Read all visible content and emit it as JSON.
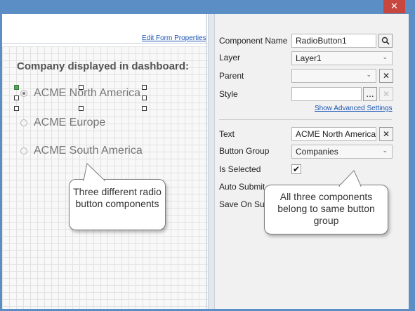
{
  "window": {
    "close_glyph": "✕"
  },
  "canvas": {
    "edit_form_link": "Edit Form Properties",
    "heading": "Company displayed in dashboard:",
    "radios": [
      {
        "label": "ACME North America",
        "selected": true
      },
      {
        "label": "ACME Europe",
        "selected": false
      },
      {
        "label": "ACME South America",
        "selected": false
      }
    ]
  },
  "properties": {
    "component_name_label": "Component Name",
    "component_name_value": "RadioButton1",
    "layer_label": "Layer",
    "layer_value": "Layer1",
    "parent_label": "Parent",
    "parent_value": "",
    "style_label": "Style",
    "style_value": "",
    "style_browse_glyph": "...",
    "show_advanced_link": "Show Advanced Settings",
    "text_label": "Text",
    "text_value": "ACME North America",
    "button_group_label": "Button Group",
    "button_group_value": "Companies",
    "is_selected_label": "Is Selected",
    "is_selected_checked": true,
    "check_glyph": "✔",
    "auto_submit_label": "Auto Submit",
    "save_on_submit_label": "Save On Sub",
    "search_icon": "search-icon",
    "clear_glyph": "✕",
    "chevron_glyph": "⌄"
  },
  "callouts": {
    "left_text": "Three different radio button components",
    "right_text": "All three components belong to same button group"
  },
  "colors": {
    "titlebar": "#5a8ec5",
    "close_button": "#c7463e",
    "link": "#1a55b4",
    "selection_handle_green": "#57a45b"
  }
}
